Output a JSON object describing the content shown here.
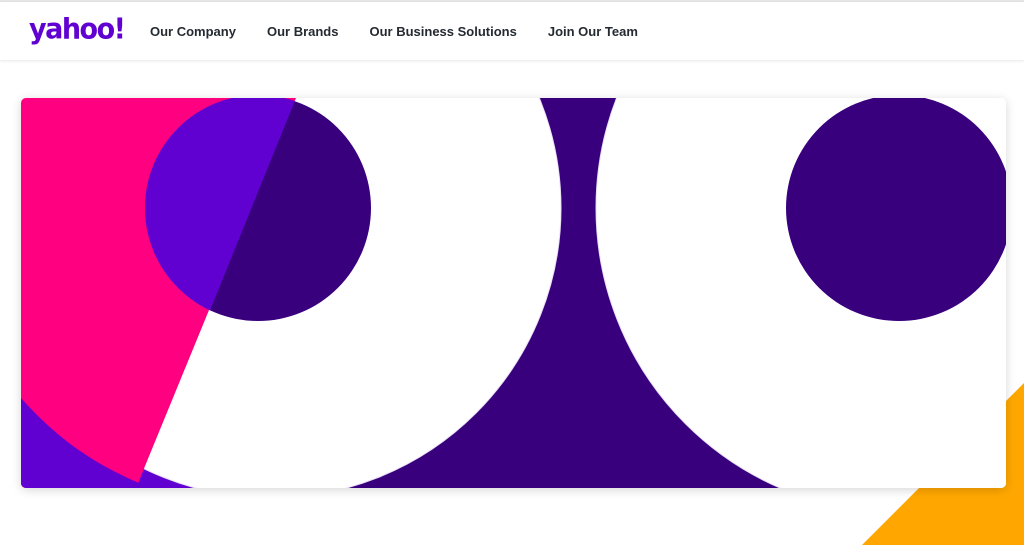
{
  "header": {
    "logo_text": "yahoo!",
    "nav": [
      {
        "label": "Our Company"
      },
      {
        "label": "Our Brands"
      },
      {
        "label": "Our Business Solutions"
      },
      {
        "label": "Join Our Team"
      }
    ]
  },
  "colors": {
    "brand_purple": "#6001d2",
    "deep_purple": "#39007d",
    "pink": "#ff0080",
    "orange": "#ffa700",
    "white": "#ffffff"
  },
  "icons": {
    "logo": "yahoo-logo-wordmark"
  }
}
